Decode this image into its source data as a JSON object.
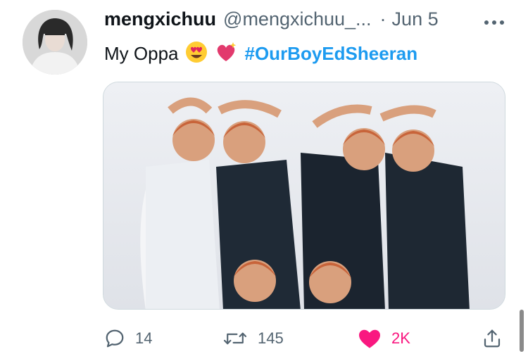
{
  "tweet": {
    "display_name": "mengxichuu",
    "handle": "@mengxichuu_...",
    "separator": "·",
    "date": "Jun 5",
    "text": "My Oppa",
    "hashtag": "#OurBoyEdSheeran"
  },
  "media": {
    "description_icon": "photo-image"
  },
  "actions": {
    "reply_count": "14",
    "retweet_count": "145",
    "like_count": "2K"
  },
  "colors": {
    "hashtag": "#1d9bf0",
    "secondary_text": "#536471",
    "like_active": "#f91880"
  }
}
